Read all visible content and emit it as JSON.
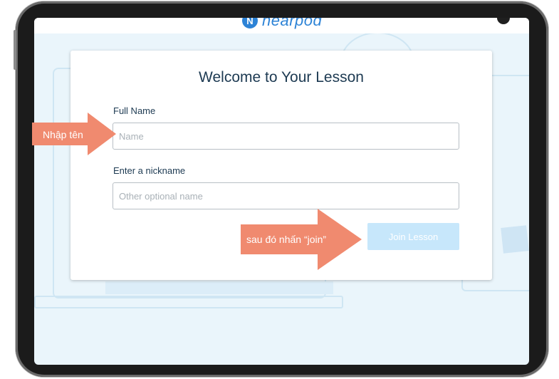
{
  "app": {
    "logo_text": "nearpod",
    "logo_glyph": "N"
  },
  "form": {
    "title": "Welcome to Your Lesson",
    "full_name_label": "Full Name",
    "full_name_placeholder": "Name",
    "nickname_label": "Enter a nickname",
    "nickname_placeholder": "Other optional name",
    "join_button": "Join Lesson"
  },
  "annotations": {
    "enter_name": "Nhập tên",
    "then_press_join": "sau đó nhấn “join”",
    "arrow_color": "#f08a6f"
  },
  "colors": {
    "accent": "#2d83d6",
    "join_button_bg": "#c7e7fb",
    "screen_bg": "#eaf5fb"
  }
}
